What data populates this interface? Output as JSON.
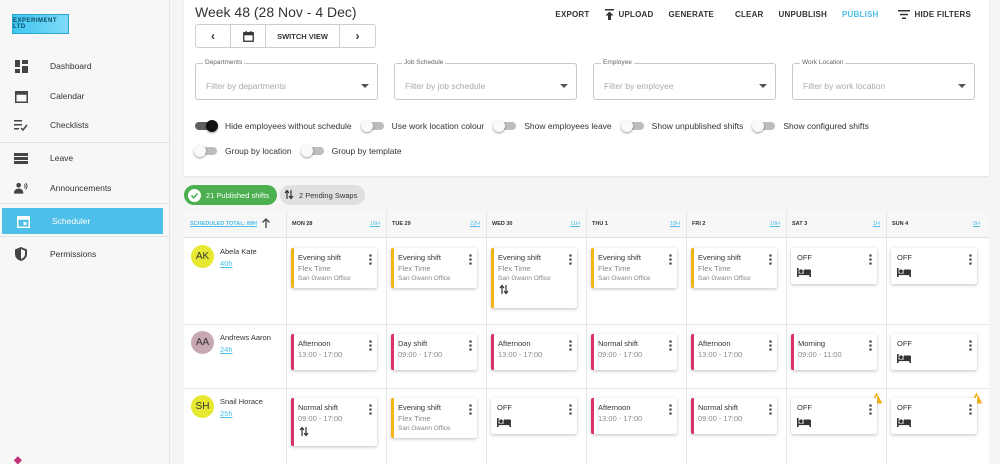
{
  "sidebar": {
    "logo_text": "EXPERIMENT LTD",
    "items": [
      {
        "label": "Dashboard",
        "icon": "dashboard-icon"
      },
      {
        "label": "Calendar",
        "icon": "calendar-icon"
      },
      {
        "label": "Checklists",
        "icon": "checklist-icon"
      },
      {
        "label": "Leave",
        "icon": "leave-icon"
      },
      {
        "label": "Announcements",
        "icon": "announcements-icon"
      },
      {
        "label": "Scheduler",
        "icon": "scheduler-icon"
      },
      {
        "label": "Permissions",
        "icon": "permissions-icon"
      }
    ],
    "active": "Scheduler"
  },
  "header": {
    "title": "Week 48 (28 Nov - 4 Dec)",
    "actions": {
      "export": "EXPORT",
      "upload": "UPLOAD",
      "generate": "GENERATE",
      "clear": "CLEAR",
      "unpublish": "UNPUBLISH",
      "publish": "PUBLISH",
      "hide_filters": "HIDE FILTERS"
    },
    "switch_view": "SWITCH VIEW",
    "accent_color": "#4dbfe8"
  },
  "filters": [
    {
      "label": "Departments",
      "placeholder": "Filter by departments"
    },
    {
      "label": "Job Schedule",
      "placeholder": "Filter by job schedule"
    },
    {
      "label": "Employee",
      "placeholder": "Filter by employee"
    },
    {
      "label": "Work Location",
      "placeholder": "Filter by work location"
    }
  ],
  "toggles": [
    {
      "label": "Hide employees without schedule",
      "on": true
    },
    {
      "label": "Use work location colour",
      "on": false
    },
    {
      "label": "Show employees leave",
      "on": false
    },
    {
      "label": "Show unpublished shifts",
      "on": false
    },
    {
      "label": "Show configured shifts",
      "on": false
    },
    {
      "label": "Group by location",
      "on": false
    },
    {
      "label": "Group by template",
      "on": false
    }
  ],
  "chips": {
    "published": "21 Published shifts",
    "pending": "2 Pending Swaps"
  },
  "grid": {
    "total_label": "SCHEDULED TOTAL: 89H",
    "days": [
      {
        "day": "MON 28",
        "hours": "16H"
      },
      {
        "day": "TUE 29",
        "hours": "22H"
      },
      {
        "day": "WED 30",
        "hours": "11H"
      },
      {
        "day": "THU 1",
        "hours": "18H"
      },
      {
        "day": "FRI 2",
        "hours": "18H"
      },
      {
        "day": "SAT 3",
        "hours": "1H"
      },
      {
        "day": "SUN 4",
        "hours": "0H"
      }
    ],
    "employees": [
      {
        "initials": "AK",
        "name": "Abela Kate",
        "hours": "40h",
        "avatar_color": "#e6e832",
        "shifts": [
          {
            "title": "Evening shift",
            "sub": "Flex Time",
            "loc": "San Gwann Office",
            "color": "yellow"
          },
          {
            "title": "Evening shift",
            "sub": "Flex Time",
            "loc": "San Gwann Office",
            "color": "yellow"
          },
          {
            "title": "Evening shift",
            "sub": "Flex Time",
            "loc": "San Gwann Office",
            "color": "yellow",
            "swap": true
          },
          {
            "title": "Evening shift",
            "sub": "Flex Time",
            "loc": "San Gwann Office",
            "color": "yellow"
          },
          {
            "title": "Evening shift",
            "sub": "Flex Time",
            "loc": "San Gwann Office",
            "color": "yellow"
          },
          {
            "title": "OFF",
            "off": true
          },
          {
            "title": "OFF",
            "off": true
          }
        ]
      },
      {
        "initials": "AA",
        "name": "Andrews Aaron",
        "hours": "24h",
        "avatar_color": "#c8a8b0",
        "shifts": [
          {
            "title": "Afternoon",
            "sub": "13:00 - 17:00",
            "color": "pink"
          },
          {
            "title": "Day shift",
            "sub": "09:00 - 17:00",
            "color": "pink"
          },
          {
            "title": "Afternoon",
            "sub": "13:00 - 17:00",
            "color": "pink"
          },
          {
            "title": "Normal shift",
            "sub": "09:00 - 17:00",
            "color": "pink"
          },
          {
            "title": "Afternoon",
            "sub": "13:00 - 17:00",
            "color": "pink"
          },
          {
            "title": "Morning",
            "sub": "09:00 - 11:00",
            "color": "pink"
          },
          {
            "title": "OFF",
            "off": true
          }
        ]
      },
      {
        "initials": "SH",
        "name": "Snail Horace",
        "hours": "25h",
        "avatar_color": "#e6e832",
        "shifts": [
          {
            "title": "Normal shift",
            "sub": "09:00 - 17:00",
            "color": "pink",
            "swap": true
          },
          {
            "title": "Evening shift",
            "sub": "Flex Time",
            "loc": "San Gwann Office",
            "color": "yellow"
          },
          {
            "title": "OFF",
            "off": true
          },
          {
            "title": "Afternoon",
            "sub": "13:00 - 17:00",
            "color": "pink"
          },
          {
            "title": "Normal shift",
            "sub": "09:00 - 17:00",
            "color": "pink"
          },
          {
            "title": "OFF",
            "off": true,
            "warn": true
          },
          {
            "title": "OFF",
            "off": true,
            "warn": true
          }
        ]
      }
    ]
  }
}
